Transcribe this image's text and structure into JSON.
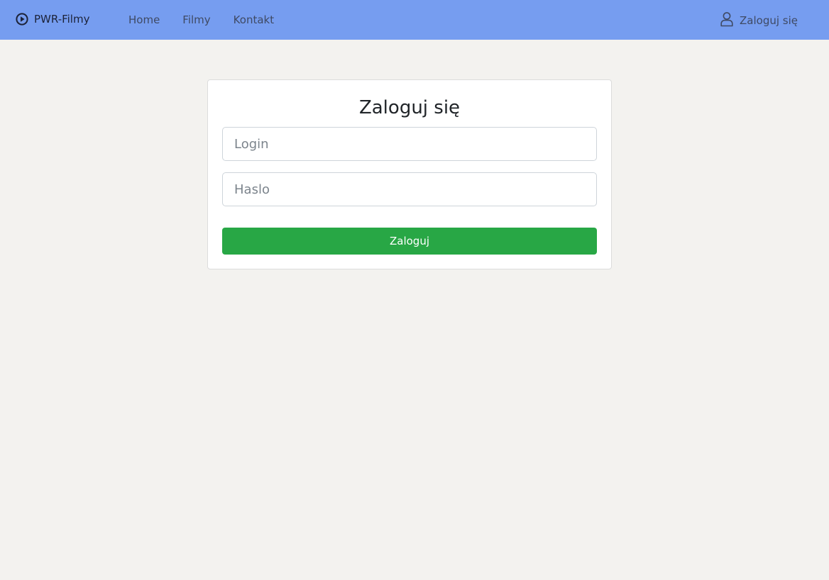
{
  "navbar": {
    "brand": {
      "icon": "play-circle-icon",
      "label": "PWR-Filmy"
    },
    "links": [
      {
        "label": "Home"
      },
      {
        "label": "Filmy"
      },
      {
        "label": "Kontakt"
      }
    ],
    "login": {
      "icon": "user-icon",
      "label": "Zaloguj się"
    }
  },
  "login_form": {
    "title": "Zaloguj się",
    "login_placeholder": "Login",
    "login_value": "",
    "password_placeholder": "Haslo",
    "password_value": "",
    "submit_label": "Zaloguj"
  },
  "colors": {
    "navbar_bg": "#769df0",
    "page_bg": "#f3f2ef",
    "button_bg": "#28a745"
  }
}
